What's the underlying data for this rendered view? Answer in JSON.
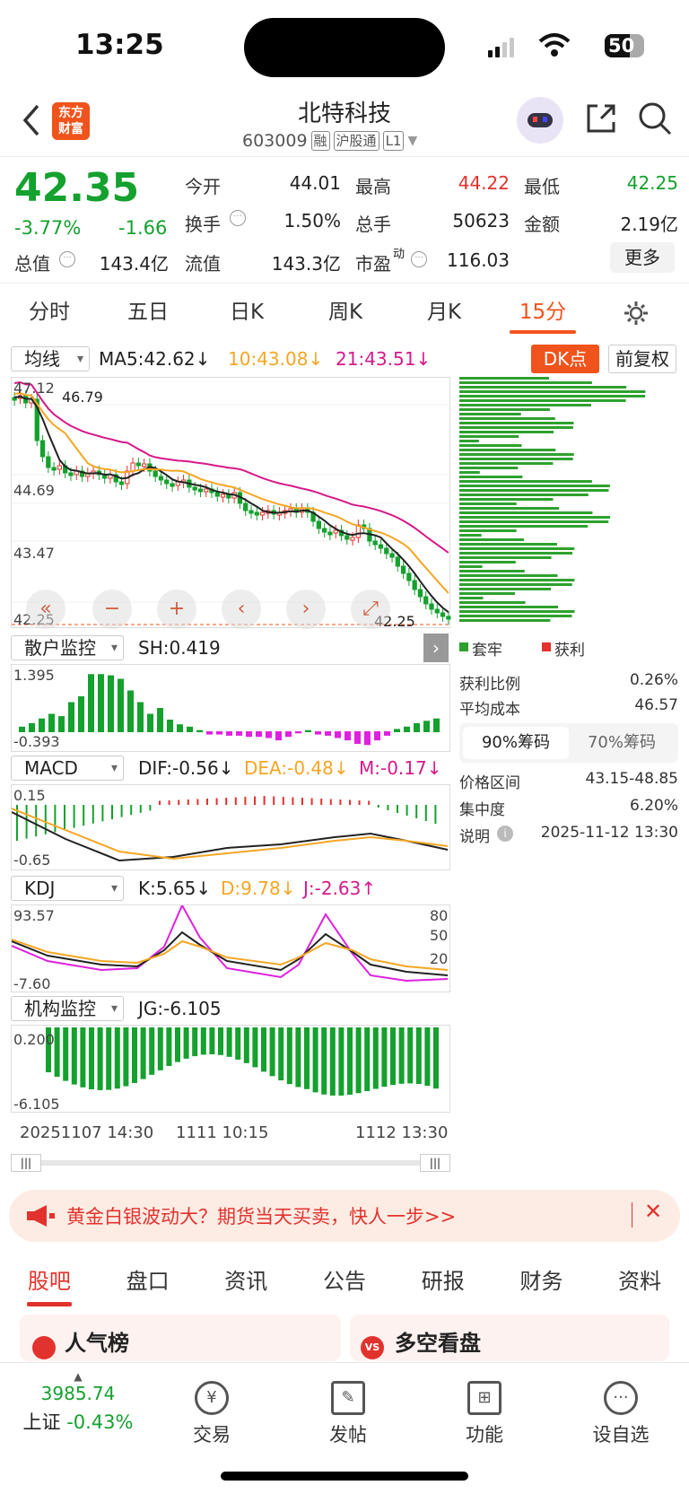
{
  "status": {
    "time": "13:25",
    "battery": "50"
  },
  "header": {
    "logo": "东方\n财富",
    "title": "北特科技",
    "code": "603009",
    "tags": [
      "融",
      "沪股通",
      "L1"
    ]
  },
  "quote": {
    "price": "42.35",
    "pct": "-3.77%",
    "chg": "-1.66",
    "fields": [
      {
        "label": "今开",
        "value": "44.01",
        "color": "#222"
      },
      {
        "label": "最高",
        "value": "44.22",
        "color": "#e2322d"
      },
      {
        "label": "最低",
        "value": "42.25",
        "color": "#14a12e"
      },
      {
        "label": "换手",
        "value": "1.50%",
        "color": "#222"
      },
      {
        "label": "总手",
        "value": "50623",
        "color": "#222"
      },
      {
        "label": "金额",
        "value": "2.19亿",
        "color": "#222"
      },
      {
        "label": "总值",
        "value": "143.4亿",
        "color": "#222"
      },
      {
        "label": "流值",
        "value": "143.3亿",
        "color": "#222"
      },
      {
        "label": "市盈",
        "value": "116.03",
        "color": "#222"
      }
    ],
    "more": "更多"
  },
  "timetabs": [
    "分时",
    "五日",
    "日K",
    "周K",
    "月K",
    "15分"
  ],
  "kline": {
    "ma_select": "均线",
    "ma5": "MA5:42.62↓",
    "ma10": "10:43.08↓",
    "ma21": "21:43.51↓",
    "dk": "DK点",
    "fq": "前复权",
    "y_top": "47.12",
    "y_mid": "44.69",
    "y_low": "43.47",
    "y_bottom": "42.25",
    "high_mark": "46.79",
    "low_mark": "42.25"
  },
  "sh": {
    "select": "散户监控",
    "value": "SH:0.419",
    "top": "1.395",
    "bottom": "-0.393"
  },
  "macd": {
    "select": "MACD",
    "dif": "DIF:-0.56↓",
    "dea": "DEA:-0.48↓",
    "m": "M:-0.17↓",
    "top": "0.15",
    "bottom": "-0.65"
  },
  "kdj": {
    "select": "KDJ",
    "k": "K:5.65↓",
    "d": "D:9.78↓",
    "j": "J:-2.63↑",
    "top": "93.57",
    "bottom": "-7.60",
    "r80": "80",
    "r50": "50",
    "r20": "20"
  },
  "jg": {
    "select": "机构监控",
    "value": "JG:-6.105",
    "top": "0.200",
    "bottom": "-6.105"
  },
  "xaxis": {
    "left": "20251107 14:30",
    "mid": "1111 10:15",
    "right": "1112 13:30"
  },
  "chips": {
    "legend_loss": "套牢",
    "legend_gain": "获利",
    "rows": [
      {
        "label": "获利比例",
        "value": "0.26%"
      },
      {
        "label": "平均成本",
        "value": "46.57"
      }
    ],
    "tab90": "90%筹码",
    "tab70": "70%筹码",
    "rows2": [
      {
        "label": "价格区间",
        "value": "43.15-48.85"
      },
      {
        "label": "集中度",
        "value": "6.20%"
      },
      {
        "label": "说明",
        "value": "2025-11-12 13:30"
      }
    ]
  },
  "banner": {
    "text": "黄金白银波动大？期货当天买卖，快人一步>>"
  },
  "bottomtabs": [
    "股吧",
    "盘口",
    "资讯",
    "公告",
    "研报",
    "财务",
    "资料"
  ],
  "cards": {
    "left": "人气榜",
    "right": "多空看盘"
  },
  "tabbar": {
    "index_value": "3985.74",
    "index_name": "上证",
    "index_pct": "-0.43%",
    "items": [
      "交易",
      "发帖",
      "功能",
      "设自选"
    ]
  }
}
